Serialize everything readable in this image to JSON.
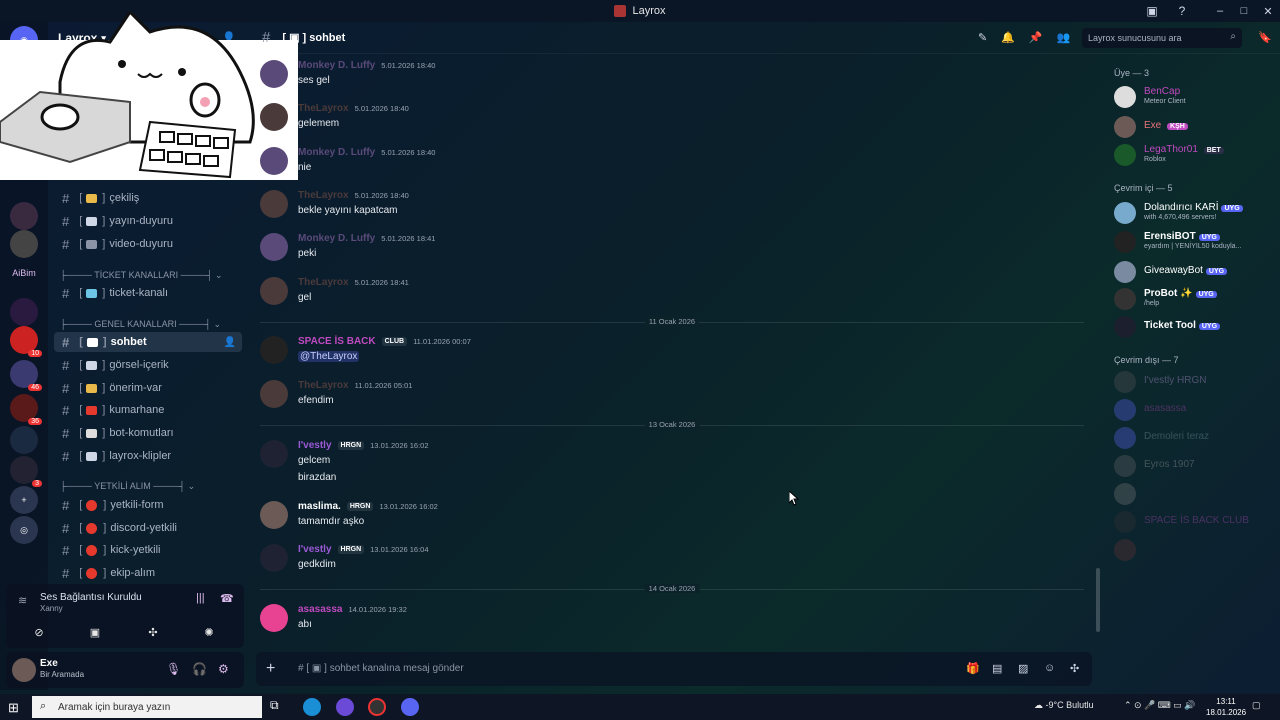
{
  "window": {
    "title": "Layrox"
  },
  "server": {
    "name": "Layrox"
  },
  "rail": {
    "label_aibim": "AiBim",
    "badges": [
      "2",
      "10",
      "46",
      "36",
      "3"
    ]
  },
  "channels": {
    "items_top": [
      {
        "icon": "#",
        "emoji_color": "#e9b949",
        "label": "çekiliş"
      },
      {
        "icon": "#",
        "emoji_color": "#cfd6e6",
        "label": "yayın-duyuru"
      },
      {
        "icon": "#",
        "emoji_color": "#8a94a6",
        "label": "video-duyuru"
      }
    ],
    "cat_ticket": "TİCKET KANALLARI",
    "ticket": {
      "label": "ticket-kanalı"
    },
    "cat_genel": "GENEL KANALLARI",
    "genel": [
      {
        "label": "sohbet",
        "active": true
      },
      {
        "label": "görsel-içerik"
      },
      {
        "label": "önerim-var"
      },
      {
        "label": "kumarhane"
      },
      {
        "label": "bot-komutları"
      },
      {
        "label": "layrox-klipler"
      }
    ],
    "cat_yetkili": "YETKİLİ ALIM",
    "yetkili": [
      {
        "label": "yetkili-form"
      },
      {
        "label": "discord-yetkili"
      },
      {
        "label": "kick-yetkili"
      },
      {
        "label": "ekip-alım"
      }
    ]
  },
  "voice": {
    "title": "Ses Bağlantısı Kuruldu",
    "sub": "Xanny"
  },
  "user": {
    "name": "Exe",
    "status": "Bir Aramada"
  },
  "chat": {
    "channel": "sohbet",
    "search_placeholder": "Layrox sunucusunu ara",
    "composer_placeholder": "sohbet kanalına mesaj gönder",
    "messages": [
      {
        "name": "Monkey D. Luffy",
        "time": "5.01.2026 18:40",
        "text": "ses gel",
        "color": "#5a4a7a"
      },
      {
        "name": "TheLayrox",
        "time": "5.01.2026 18:40",
        "text": "gelemem",
        "color": "#4b3a3a"
      },
      {
        "name": "Monkey D. Luffy",
        "time": "5.01.2026 18:40",
        "text": "nie",
        "color": "#5a4a7a"
      },
      {
        "name": "TheLayrox",
        "time": "5.01.2026 18:40",
        "text": "bekle yayını kapatcam",
        "color": "#4b3a3a"
      },
      {
        "name": "Monkey D. Luffy",
        "time": "5.01.2026 18:41",
        "text": "peki",
        "color": "#5a4a7a"
      },
      {
        "name": "TheLayrox",
        "time": "5.01.2026 18:41",
        "text": "gel",
        "color": "#4b3a3a"
      },
      {
        "name": "SPACE İS BACK",
        "tag": "CLUB",
        "time": "11.01.2026 00:07",
        "text": "@TheLayrox",
        "color": "#c04ac0"
      },
      {
        "name": "TheLayrox",
        "time": "11.01.2026 05:01",
        "text": "efendim",
        "color": "#4b3a3a"
      },
      {
        "name": "I'vestly",
        "tag": "HRGN",
        "time": "13.01.2026 16:02",
        "text": "gelcem",
        "text2": "birazdan",
        "color": "#9b59d6"
      },
      {
        "name": "maslima.",
        "tag": "HRGN",
        "time": "13.01.2026 16:02",
        "text": "tamamdır aşko",
        "color": "#ffffff"
      },
      {
        "name": "I'vestly",
        "tag": "HRGN",
        "time": "13.01.2026 16:04",
        "text": "gedkdim",
        "color": "#9b59d6"
      },
      {
        "name": "asasassa",
        "time": "14.01.2026 19:32",
        "text": "abı",
        "color": "#c04ac0"
      }
    ],
    "dividers": [
      "11 Ocak 2026",
      "13 Ocak 2026",
      "14 Ocak 2026"
    ]
  },
  "members": {
    "group1": "Üye — 3",
    "group1_items": [
      {
        "name": "BenCap",
        "status": "Meteor Client",
        "color": "#c04ac0"
      },
      {
        "name": "Exe",
        "tag": "KŞH",
        "color": "#e9737a"
      },
      {
        "name": "LegaThor01",
        "tag": "BET",
        "status": "Roblox",
        "color": "#c04ac0"
      }
    ],
    "group2": "Çevrim içi — 5",
    "group2_items": [
      {
        "name": "Dolandırıcı KARİ",
        "status": "with 4,670,496 servers!"
      },
      {
        "name": "ErensiBOT",
        "status": "eyardım | YENİYIL50 koduyla..."
      },
      {
        "name": "GiveawayBot"
      },
      {
        "name": "ProBot ✨",
        "status": "/help"
      },
      {
        "name": "Ticket Tool"
      }
    ],
    "uyg_label": "UYG",
    "group3": "Çevrim dışı — 7",
    "group3_items": [
      {
        "name": "I'vestly",
        "tag": "HRGN"
      },
      {
        "name": "asasassa"
      },
      {
        "name": "Demoleri teraz"
      },
      {
        "name": "Eyros",
        "tag": "1907"
      },
      {
        "name": ""
      },
      {
        "name": "SPACE İS BACK",
        "tag": "CLUB"
      },
      {
        "name": ""
      }
    ]
  },
  "taskbar": {
    "search": "Aramak için buraya yazın",
    "weather": "-9°C Bulutlu",
    "time": "13:11",
    "date": "18.01.2026"
  }
}
